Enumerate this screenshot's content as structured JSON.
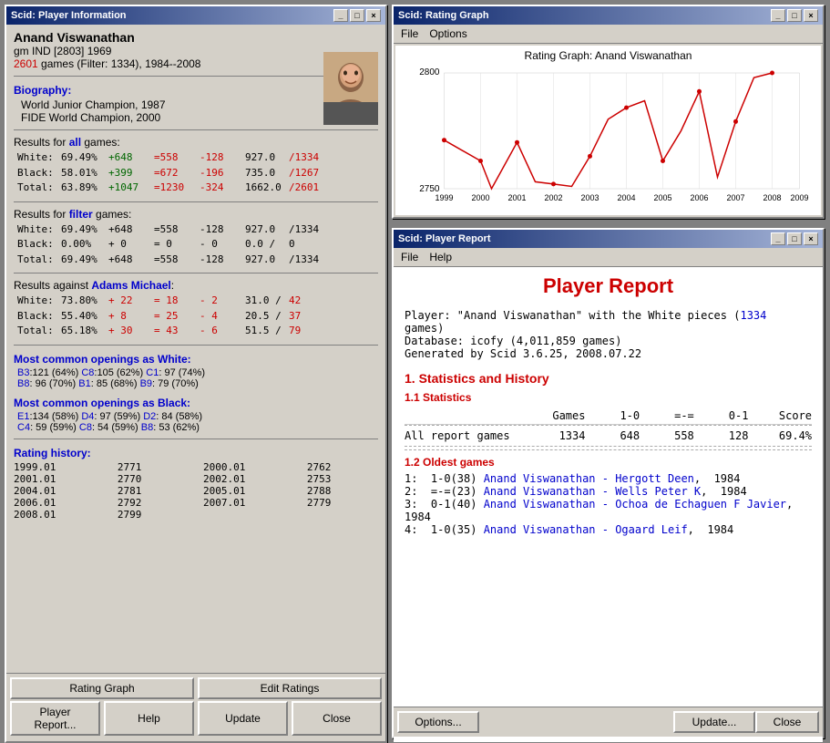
{
  "playerInfo": {
    "windowTitle": "Scid: Player Information",
    "playerName": "Anand Viswanathan",
    "title": "gm",
    "country": "IND",
    "rating": "[2803]",
    "year": "1969",
    "games": "2601",
    "gamesLabel": "games (Filter: 1334), 1984--2008",
    "biography": {
      "label": "Biography:",
      "lines": [
        "World Junior Champion, 1987",
        "FIDE World Champion, 2000"
      ]
    },
    "resultsAll": {
      "label": "Results for all games:",
      "rows": [
        {
          "side": "White:",
          "pct": "69.49%",
          "w": "+648",
          "d": "=558",
          "l": "-128",
          "score": "927.0",
          "total": "/1334"
        },
        {
          "side": "Black:",
          "pct": "58.01%",
          "w": "+399",
          "d": "=672",
          "l": "-196",
          "score": "735.0",
          "total": "/1267"
        },
        {
          "side": "Total:",
          "pct": "63.89%",
          "w": "+1047",
          "d": "=1230",
          "l": "-324",
          "score": "1662.0",
          "total": "/2601"
        }
      ]
    },
    "resultsFilter": {
      "label": "Results for filter games:",
      "rows": [
        {
          "side": "White:",
          "pct": "69.49%",
          "w": "+648",
          "d": "=558",
          "l": "-128",
          "score": "927.0",
          "total": "/1334"
        },
        {
          "side": "Black:",
          "pct": "0.00%",
          "w": "+ 0",
          "d": "= 0",
          "l": "- 0",
          "score": "0.0 /",
          "total": " 0"
        },
        {
          "side": "Total:",
          "pct": "69.49%",
          "w": "+648",
          "d": "=558",
          "l": "-128",
          "score": "927.0",
          "total": "/1334"
        }
      ]
    },
    "resultsAgainst": {
      "label": "Results against",
      "player": "Adams Michael",
      "rows": [
        {
          "side": "White:",
          "pct": "73.80%",
          "w": "+ 22",
          "d": "= 18",
          "l": "- 2",
          "score": "31.0 /",
          "total": "42"
        },
        {
          "side": "Black:",
          "pct": "55.40%",
          "w": "+ 8",
          "d": "= 25",
          "l": "- 4",
          "score": "20.5 /",
          "total": "37"
        },
        {
          "side": "Total:",
          "pct": "65.18%",
          "w": "+ 30",
          "d": "= 43",
          "l": "- 6",
          "score": "51.5 /",
          "total": "79"
        }
      ]
    },
    "openingsWhite": {
      "label": "Most common openings as White:",
      "items": [
        "B3:121 (64%)  C8:105 (62%)  C1: 97 (74%)",
        "B8: 96 (70%)  B1: 85 (68%)  B9: 79 (70%)"
      ]
    },
    "openingsBlack": {
      "label": "Most common openings as Black:",
      "items": [
        "E1:134 (58%)  D4: 97 (59%)  D2: 84 (58%)",
        "C4: 59 (59%)  C8: 54 (59%)  B8: 53 (62%)"
      ]
    },
    "ratingHistory": {
      "label": "Rating history:",
      "entries": [
        [
          "1999.01",
          "2771",
          "2000.01",
          "2762"
        ],
        [
          "2001.01",
          "2770",
          "2002.01",
          "2753"
        ],
        [
          "2004.01",
          "2781",
          "2005.01",
          "2788"
        ],
        [
          "2006.01",
          "2792",
          "2007.01",
          "2779"
        ],
        [
          "2008.01",
          "2799",
          "",
          ""
        ]
      ]
    },
    "buttons": {
      "ratingGraph": "Rating Graph",
      "editRatings": "Edit Ratings",
      "playerReport": "Player Report...",
      "help": "Help",
      "update": "Update",
      "close": "Close"
    }
  },
  "ratingGraph": {
    "windowTitle": "Scid: Rating Graph",
    "menuFile": "File",
    "menuOptions": "Options",
    "title": "Rating Graph: Anand Viswanathan",
    "yMin": 2750,
    "yMax": 2800,
    "xLabels": [
      "1999",
      "2000",
      "2001",
      "2002",
      "2003",
      "2004",
      "2005",
      "2006",
      "2007",
      "2008",
      "2009"
    ],
    "dataPoints": [
      {
        "year": 1999,
        "rating": 2771
      },
      {
        "year": 2000,
        "rating": 2762
      },
      {
        "year": 2000.5,
        "rating": 2745
      },
      {
        "year": 2001,
        "rating": 2770
      },
      {
        "year": 2001.5,
        "rating": 2753
      },
      {
        "year": 2002,
        "rating": 2752
      },
      {
        "year": 2002.5,
        "rating": 2751
      },
      {
        "year": 2003,
        "rating": 2764
      },
      {
        "year": 2003.5,
        "rating": 2780
      },
      {
        "year": 2004,
        "rating": 2785
      },
      {
        "year": 2004.5,
        "rating": 2788
      },
      {
        "year": 2005,
        "rating": 2762
      },
      {
        "year": 2005.5,
        "rating": 2775
      },
      {
        "year": 2006,
        "rating": 2792
      },
      {
        "year": 2006.5,
        "rating": 2755
      },
      {
        "year": 2007,
        "rating": 2779
      },
      {
        "year": 2007.5,
        "rating": 2798
      },
      {
        "year": 2008,
        "rating": 2800
      }
    ]
  },
  "playerReport": {
    "windowTitle": "Scid: Player Report",
    "menuFile": "File",
    "menuHelp": "Help",
    "title": "Player Report",
    "playerLine": "Player: \"Anand Viswanathan\" with the White pieces (1334 games)",
    "playerGamesLink": "1334",
    "databaseLine": "Database: icofy (4,011,859 games)",
    "generatedLine": "Generated by Scid 3.6.25, 2008.07.22",
    "section1": "1. Statistics and History",
    "section11": "1.1 Statistics",
    "tableHeaders": [
      "Games",
      "1-0",
      "=-=",
      "0-1",
      "Score"
    ],
    "tableRow": [
      "All report games",
      "1334",
      "648",
      "558",
      "128",
      "69.4%"
    ],
    "section12": "1.2 Oldest games",
    "oldestGames": [
      "1:  1-0(38) Anand Viswanathan - Hergott Deen,  1984",
      "2:  =-=(23) Anand Viswanathan - Wells Peter K,  1984",
      "3:  0-1(40) Anand Viswanathan - Ochoa de Echaguen F Javier,  1984",
      "4:  1-0(35) Anand Viswanathan - Ogaard Leif,  1984"
    ],
    "buttons": {
      "options": "Options...",
      "update": "Update...",
      "close": "Close"
    }
  }
}
